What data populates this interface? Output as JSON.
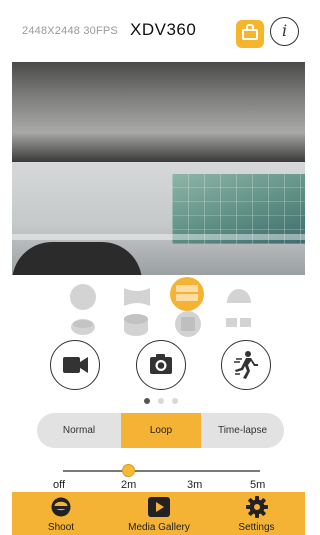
{
  "header": {
    "resolution": "2448X2448 30FPS",
    "model": "XDV360"
  },
  "lens_modes": [
    {
      "icon": "sphere-view-icon",
      "selected": false
    },
    {
      "icon": "panorama-view-icon",
      "selected": false
    },
    {
      "icon": "split-view-icon",
      "selected": true
    },
    {
      "icon": "dome-view-icon",
      "selected": false
    },
    {
      "icon": "bowl-view-icon",
      "selected": false
    },
    {
      "icon": "cylinder-view-icon",
      "selected": false
    },
    {
      "icon": "cube-view-icon",
      "selected": false
    },
    {
      "icon": "dual-view-icon",
      "selected": false
    }
  ],
  "shoot_modes": [
    {
      "icon": "video-camera-icon"
    },
    {
      "icon": "photo-camera-icon"
    },
    {
      "icon": "motion-icon"
    }
  ],
  "pager": {
    "count": 3,
    "active_index": 0
  },
  "record_modes": {
    "options": [
      "Normal",
      "Loop",
      "Time-lapse"
    ],
    "selected": "Loop"
  },
  "loop_duration": {
    "labels": [
      "off",
      "2m",
      "3m",
      "5m"
    ],
    "selected": "2m"
  },
  "tabbar": {
    "items": [
      {
        "label": "Shoot",
        "icon": "shoot-icon",
        "active": true
      },
      {
        "label": "Media Gallery",
        "icon": "play-icon",
        "active": false
      },
      {
        "label": "Settings",
        "icon": "gear-icon",
        "active": false
      }
    ]
  },
  "colors": {
    "accent": "#f5b335",
    "segment_bg": "#e2e2e2",
    "icon_gray": "#d3d3d3"
  }
}
